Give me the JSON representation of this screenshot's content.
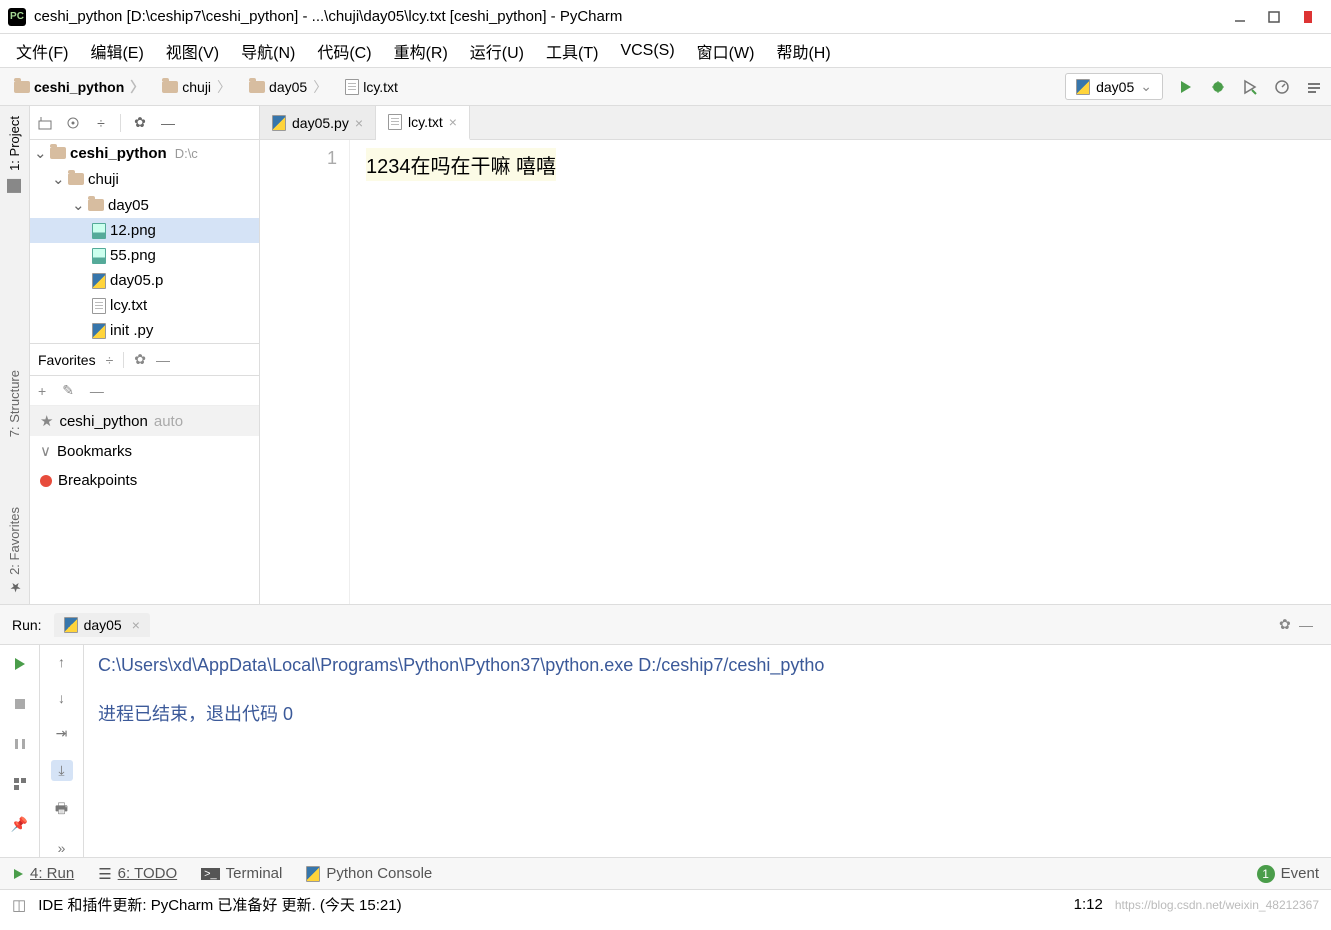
{
  "titlebar": {
    "title": "ceshi_python [D:\\ceship7\\ceshi_python] - ...\\chuji\\day05\\lcy.txt [ceshi_python] - PyCharm"
  },
  "menu": [
    "文件(F)",
    "编辑(E)",
    "视图(V)",
    "导航(N)",
    "代码(C)",
    "重构(R)",
    "运行(U)",
    "工具(T)",
    "VCS(S)",
    "窗口(W)",
    "帮助(H)"
  ],
  "breadcrumbs": [
    {
      "label": "ceshi_python",
      "bold": true,
      "icon": "folder"
    },
    {
      "label": "chuji",
      "icon": "folder"
    },
    {
      "label": "day05",
      "icon": "folder"
    },
    {
      "label": "lcy.txt",
      "icon": "txt"
    }
  ],
  "run_config": "day05",
  "sidebar": {
    "project": "1: Project",
    "structure": "7: Structure",
    "favorites": "2: Favorites"
  },
  "tree": {
    "root": {
      "name": "ceshi_python",
      "loc": "D:\\c"
    },
    "chuji": "chuji",
    "day05": "day05",
    "files": [
      "12.png",
      "55.png",
      "day05.p",
      "lcy.txt",
      "init  .py"
    ]
  },
  "favorites": {
    "title": "Favorites",
    "items": [
      {
        "label": "ceshi_python",
        "suffix": "auto",
        "icon": "star"
      },
      {
        "label": "Bookmarks",
        "icon": "check"
      },
      {
        "label": "Breakpoints",
        "icon": "red"
      }
    ]
  },
  "tabs": [
    {
      "label": "day05.py",
      "icon": "py",
      "active": false
    },
    {
      "label": "lcy.txt",
      "icon": "txt",
      "active": true
    }
  ],
  "editor": {
    "line_no": "1",
    "content": "1234在吗在干嘛 嘻嘻"
  },
  "run": {
    "label": "Run:",
    "tab": "day05",
    "output_line1": "C:\\Users\\xd\\AppData\\Local\\Programs\\Python\\Python37\\python.exe D:/ceship7/ceshi_pytho",
    "output_line2": "进程已结束，退出代码 0"
  },
  "bottom": {
    "run": "4: Run",
    "todo": "6: TODO",
    "terminal": "Terminal",
    "console": "Python Console",
    "event": "Event"
  },
  "status": {
    "msg": "IDE 和插件更新: PyCharm 已准备好 更新. (今天 15:21)",
    "pos": "1:12",
    "watermark": "https://blog.csdn.net/weixin_48212367"
  }
}
